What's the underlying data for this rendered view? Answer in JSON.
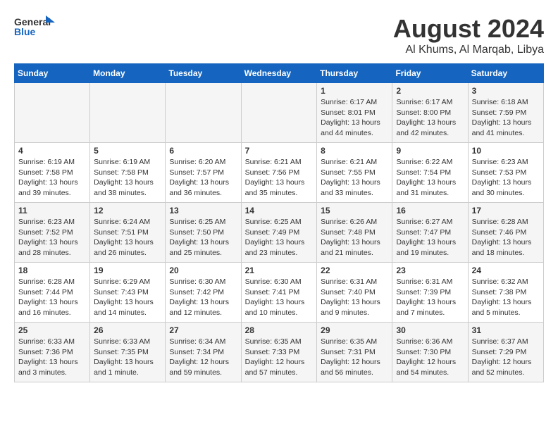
{
  "logo": {
    "line1": "General",
    "line2": "Blue"
  },
  "title": "August 2024",
  "subtitle": "Al Khums, Al Marqab, Libya",
  "days_of_week": [
    "Sunday",
    "Monday",
    "Tuesday",
    "Wednesday",
    "Thursday",
    "Friday",
    "Saturday"
  ],
  "weeks": [
    {
      "id": "week1",
      "days": [
        {
          "num": "",
          "info": ""
        },
        {
          "num": "",
          "info": ""
        },
        {
          "num": "",
          "info": ""
        },
        {
          "num": "",
          "info": ""
        },
        {
          "num": "1",
          "info": "Sunrise: 6:17 AM\nSunset: 8:01 PM\nDaylight: 13 hours\nand 44 minutes."
        },
        {
          "num": "2",
          "info": "Sunrise: 6:17 AM\nSunset: 8:00 PM\nDaylight: 13 hours\nand 42 minutes."
        },
        {
          "num": "3",
          "info": "Sunrise: 6:18 AM\nSunset: 7:59 PM\nDaylight: 13 hours\nand 41 minutes."
        }
      ]
    },
    {
      "id": "week2",
      "days": [
        {
          "num": "4",
          "info": "Sunrise: 6:19 AM\nSunset: 7:58 PM\nDaylight: 13 hours\nand 39 minutes."
        },
        {
          "num": "5",
          "info": "Sunrise: 6:19 AM\nSunset: 7:58 PM\nDaylight: 13 hours\nand 38 minutes."
        },
        {
          "num": "6",
          "info": "Sunrise: 6:20 AM\nSunset: 7:57 PM\nDaylight: 13 hours\nand 36 minutes."
        },
        {
          "num": "7",
          "info": "Sunrise: 6:21 AM\nSunset: 7:56 PM\nDaylight: 13 hours\nand 35 minutes."
        },
        {
          "num": "8",
          "info": "Sunrise: 6:21 AM\nSunset: 7:55 PM\nDaylight: 13 hours\nand 33 minutes."
        },
        {
          "num": "9",
          "info": "Sunrise: 6:22 AM\nSunset: 7:54 PM\nDaylight: 13 hours\nand 31 minutes."
        },
        {
          "num": "10",
          "info": "Sunrise: 6:23 AM\nSunset: 7:53 PM\nDaylight: 13 hours\nand 30 minutes."
        }
      ]
    },
    {
      "id": "week3",
      "days": [
        {
          "num": "11",
          "info": "Sunrise: 6:23 AM\nSunset: 7:52 PM\nDaylight: 13 hours\nand 28 minutes."
        },
        {
          "num": "12",
          "info": "Sunrise: 6:24 AM\nSunset: 7:51 PM\nDaylight: 13 hours\nand 26 minutes."
        },
        {
          "num": "13",
          "info": "Sunrise: 6:25 AM\nSunset: 7:50 PM\nDaylight: 13 hours\nand 25 minutes."
        },
        {
          "num": "14",
          "info": "Sunrise: 6:25 AM\nSunset: 7:49 PM\nDaylight: 13 hours\nand 23 minutes."
        },
        {
          "num": "15",
          "info": "Sunrise: 6:26 AM\nSunset: 7:48 PM\nDaylight: 13 hours\nand 21 minutes."
        },
        {
          "num": "16",
          "info": "Sunrise: 6:27 AM\nSunset: 7:47 PM\nDaylight: 13 hours\nand 19 minutes."
        },
        {
          "num": "17",
          "info": "Sunrise: 6:28 AM\nSunset: 7:46 PM\nDaylight: 13 hours\nand 18 minutes."
        }
      ]
    },
    {
      "id": "week4",
      "days": [
        {
          "num": "18",
          "info": "Sunrise: 6:28 AM\nSunset: 7:44 PM\nDaylight: 13 hours\nand 16 minutes."
        },
        {
          "num": "19",
          "info": "Sunrise: 6:29 AM\nSunset: 7:43 PM\nDaylight: 13 hours\nand 14 minutes."
        },
        {
          "num": "20",
          "info": "Sunrise: 6:30 AM\nSunset: 7:42 PM\nDaylight: 13 hours\nand 12 minutes."
        },
        {
          "num": "21",
          "info": "Sunrise: 6:30 AM\nSunset: 7:41 PM\nDaylight: 13 hours\nand 10 minutes."
        },
        {
          "num": "22",
          "info": "Sunrise: 6:31 AM\nSunset: 7:40 PM\nDaylight: 13 hours\nand 9 minutes."
        },
        {
          "num": "23",
          "info": "Sunrise: 6:31 AM\nSunset: 7:39 PM\nDaylight: 13 hours\nand 7 minutes."
        },
        {
          "num": "24",
          "info": "Sunrise: 6:32 AM\nSunset: 7:38 PM\nDaylight: 13 hours\nand 5 minutes."
        }
      ]
    },
    {
      "id": "week5",
      "days": [
        {
          "num": "25",
          "info": "Sunrise: 6:33 AM\nSunset: 7:36 PM\nDaylight: 13 hours\nand 3 minutes."
        },
        {
          "num": "26",
          "info": "Sunrise: 6:33 AM\nSunset: 7:35 PM\nDaylight: 13 hours\nand 1 minute."
        },
        {
          "num": "27",
          "info": "Sunrise: 6:34 AM\nSunset: 7:34 PM\nDaylight: 12 hours\nand 59 minutes."
        },
        {
          "num": "28",
          "info": "Sunrise: 6:35 AM\nSunset: 7:33 PM\nDaylight: 12 hours\nand 57 minutes."
        },
        {
          "num": "29",
          "info": "Sunrise: 6:35 AM\nSunset: 7:31 PM\nDaylight: 12 hours\nand 56 minutes."
        },
        {
          "num": "30",
          "info": "Sunrise: 6:36 AM\nSunset: 7:30 PM\nDaylight: 12 hours\nand 54 minutes."
        },
        {
          "num": "31",
          "info": "Sunrise: 6:37 AM\nSunset: 7:29 PM\nDaylight: 12 hours\nand 52 minutes."
        }
      ]
    }
  ]
}
